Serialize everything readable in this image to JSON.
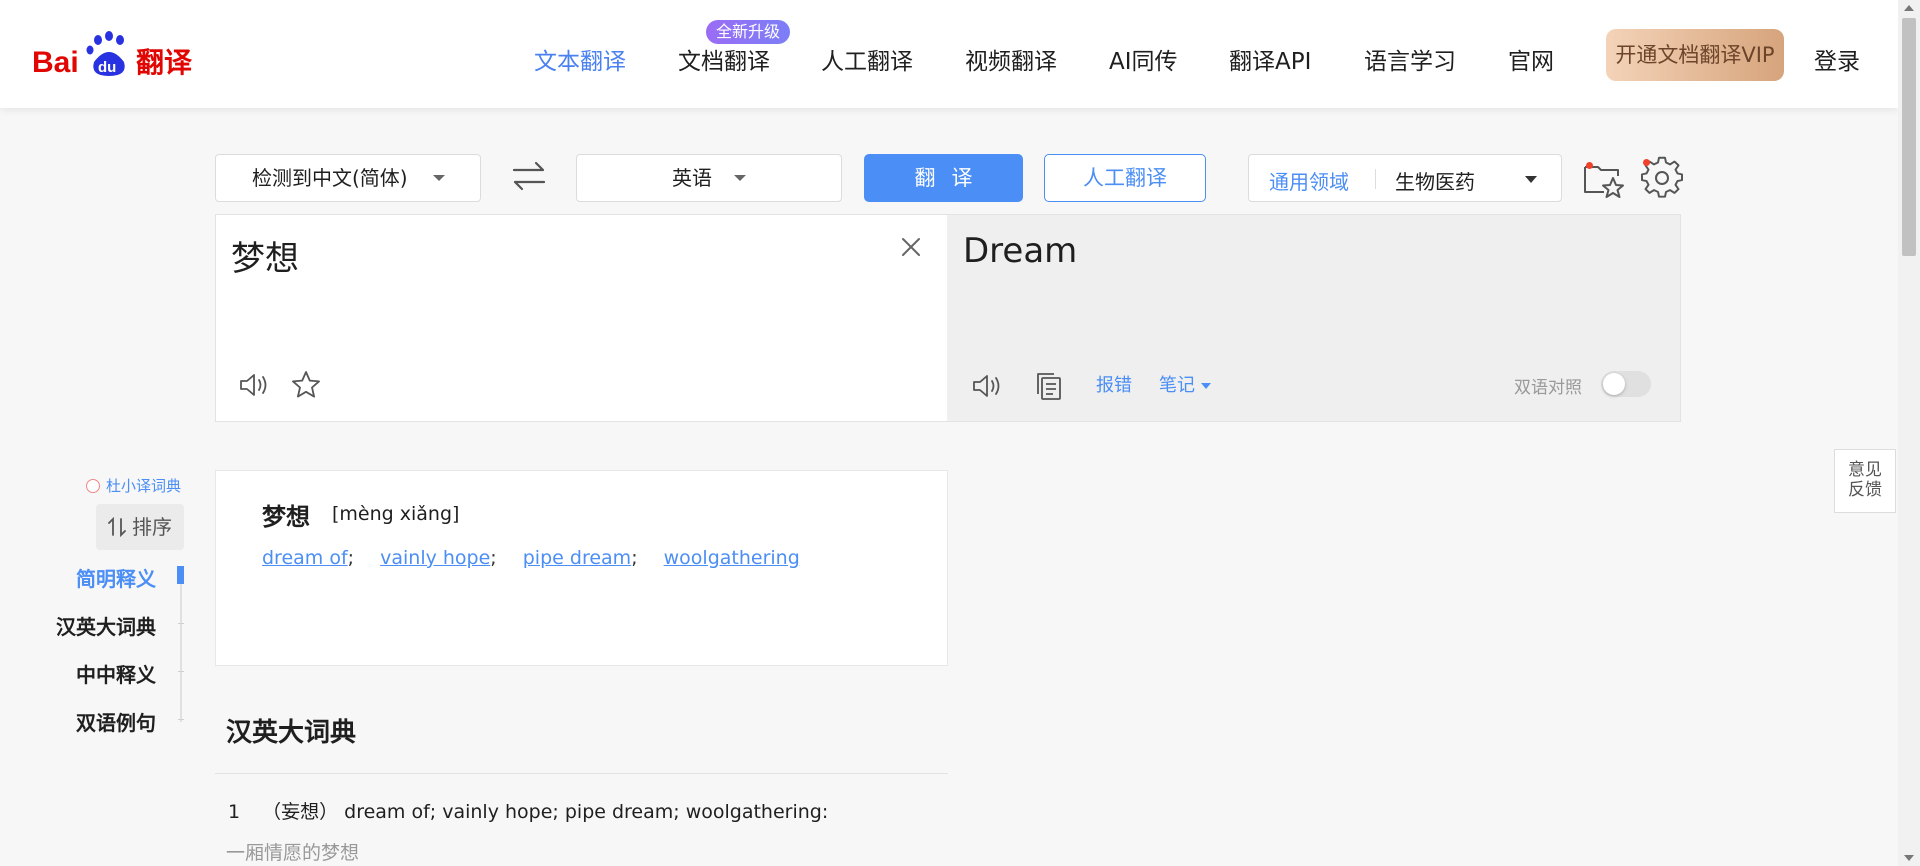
{
  "header": {
    "logo_alt": "Bai du 翻译",
    "nav": [
      {
        "label": "文本翻译",
        "active": true
      },
      {
        "label": "文档翻译",
        "active": false
      },
      {
        "label": "人工翻译",
        "active": false
      },
      {
        "label": "视频翻译",
        "active": false
      },
      {
        "label": "AI同传",
        "active": false
      },
      {
        "label": "翻译API",
        "active": false
      },
      {
        "label": "语言学习",
        "active": false
      },
      {
        "label": "官网",
        "active": false
      }
    ],
    "badge": "全新升级",
    "vip_button": "开通文档翻译VIP",
    "login": "登录"
  },
  "toolbar": {
    "source_language": "检测到中文(简体)",
    "target_language": "英语",
    "translate_button": "翻译",
    "human_translate_button": "人工翻译",
    "domain_label": "通用领域",
    "domain_value": "生物医药"
  },
  "source": {
    "text": "梦想"
  },
  "result": {
    "text": "Dream",
    "report_error": "报错",
    "notes": "笔记",
    "bilingual_label": "双语对照",
    "bilingual_on": false
  },
  "sidebar": {
    "brand": "杜小译词典",
    "sort_label": "排序",
    "items": [
      {
        "label": "简明释义",
        "active": true
      },
      {
        "label": "汉英大词典",
        "active": false
      },
      {
        "label": "中中释义",
        "active": false
      },
      {
        "label": "双语例句",
        "active": false
      }
    ]
  },
  "dict_card": {
    "word": "梦想",
    "pinyin": "[mèng xiǎng]",
    "definitions": [
      "dream of",
      "vainly hope",
      "pipe dream",
      "woolgathering"
    ]
  },
  "big_dict": {
    "title": "汉英大词典",
    "entry_number": "1",
    "entry_text": "（妄想） dream of; vainly hope; pipe dream; woolgathering:",
    "entry_example": "一厢情愿的梦想"
  },
  "feedback": {
    "line1": "意见",
    "line2": "反馈"
  },
  "colors": {
    "accent": "#4b8ef5",
    "vip_gradient_start": "#f4d3b8",
    "vip_gradient_end": "#d6a47c",
    "badge_gradient_start": "#9b6cf5"
  },
  "icons": [
    "swap-icon",
    "favorites-icon",
    "settings-icon",
    "speaker-icon",
    "star-icon",
    "copy-icon",
    "close-icon"
  ]
}
